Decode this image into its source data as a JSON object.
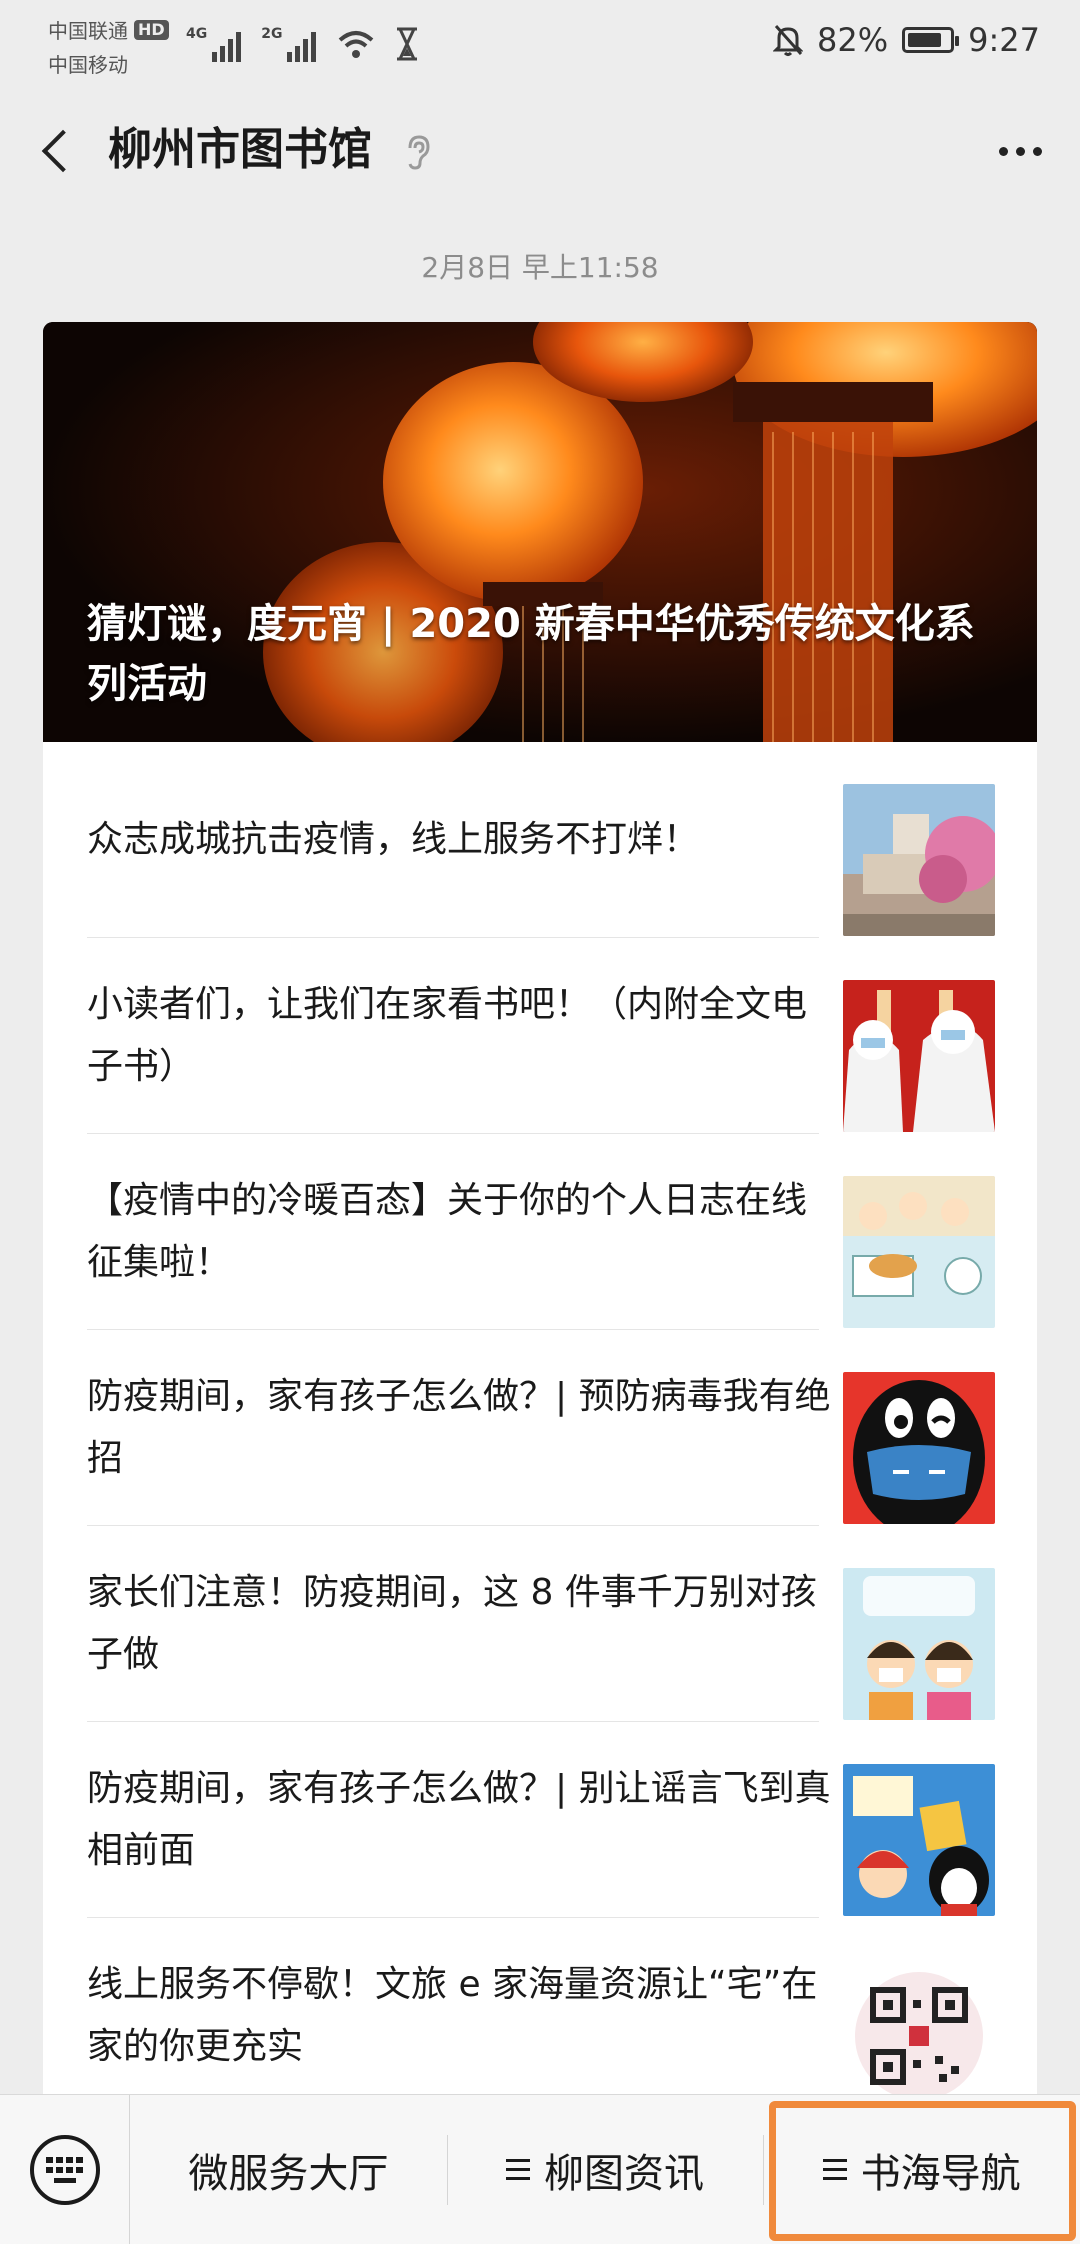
{
  "status_bar": {
    "carrier_1": "中国联通",
    "carrier_1_badge": "HD",
    "carrier_2": "中国移动",
    "signal_1_label": "4G",
    "signal_2_label": "2G",
    "battery_percent": "82%",
    "battery_level": 0.82,
    "time": "9:27",
    "icons": [
      "signal-icon",
      "signal-icon",
      "wifi-icon",
      "hourglass-icon",
      "mute-bell-icon",
      "battery-icon"
    ]
  },
  "header": {
    "title": "柳州市图书馆",
    "icons": [
      "back-arrow-icon",
      "ear-icon",
      "more-dots-icon"
    ]
  },
  "message": {
    "timestamp": "2月8日 早上11:58",
    "cover_title": "猜灯谜，度元宵 | 2020 新春中华优秀传统文化系列活动",
    "articles": [
      {
        "title": "众志成城抗击疫情，线上服务不打烊！"
      },
      {
        "title": "小读者们，让我们在家看书吧！（内附全文电子书）"
      },
      {
        "title": "【疫情中的冷暖百态】关于你的个人日志在线征集啦！"
      },
      {
        "title": "防疫期间，家有孩子怎么做？| 预防病毒我有绝招"
      },
      {
        "title": "家长们注意！防疫期间，这 8 件事千万别对孩子做"
      },
      {
        "title": "防疫期间，家有孩子怎么做？| 别让谣言飞到真相前面"
      },
      {
        "title": "线上服务不停歇！文旅 e 家海量资源让“宅”在家的你更充实"
      }
    ]
  },
  "bottom_menu": {
    "keyboard_icon": "keyboard-icon",
    "items": [
      {
        "label": "微服务大厅",
        "has_icon": false
      },
      {
        "label": "柳图资讯",
        "has_icon": true
      },
      {
        "label": "书海导航",
        "has_icon": true,
        "highlighted": true
      }
    ],
    "highlight_color": "#f08a3c"
  }
}
